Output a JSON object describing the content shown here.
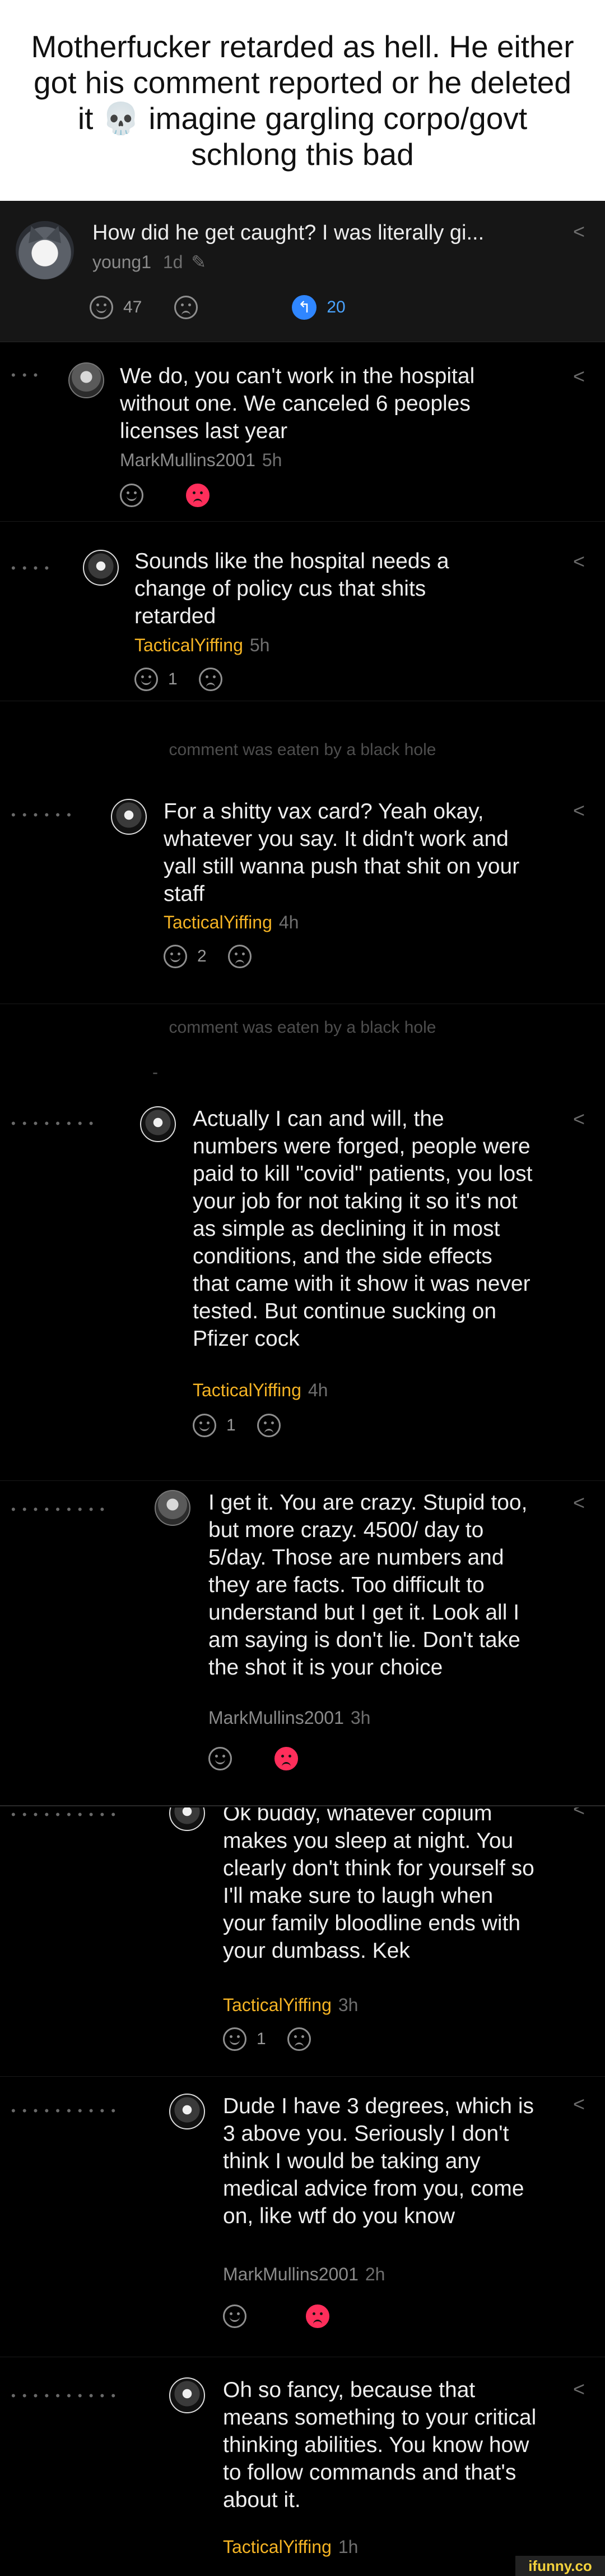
{
  "caption": "Motherfucker retarded as hell. He either got his comment reported or he deleted it 💀 imagine gargling corpo/govt schlong this bad",
  "post": {
    "title": "How did he get caught? I was literally gi...",
    "username": "young1",
    "age": "1d",
    "like_count": "47",
    "reply_count": "20"
  },
  "comments": [
    {
      "text": "We do, you can't work in the hospital without one. We canceled 6 peoples licenses last year",
      "username": "MarkMullins2001",
      "age": "5h",
      "like_count": "",
      "depth_dots": "• • •"
    },
    {
      "text": "Sounds like the hospital needs a change of policy cus that shits retarded",
      "username": "TacticalYiffing",
      "age": "5h",
      "like_count": "1",
      "depth_dots": "• • • •"
    },
    {
      "text": "For a shitty vax card? Yeah okay, whatever you say. It didn't work and yall still wanna push that shit on your staff",
      "username": "TacticalYiffing",
      "age": "4h",
      "like_count": "2",
      "depth_dots": "• • • • • •"
    },
    {
      "text": "Actually I can and will, the numbers were forged, people were paid to kill \"covid\" patients, you lost your job for not taking it so it's not as simple as declining it in most conditions, and the side effects that came with it show it was never tested. But continue sucking on Pfizer cock",
      "username": "TacticalYiffing",
      "age": "4h",
      "like_count": "1",
      "depth_dots": "• • • • • • • •"
    },
    {
      "text": "I get it. You are crazy. Stupid too, but more crazy. 4500/ day to 5/day. Those are numbers and they are facts. Too difficult to understand but I get it. Look all I am saying is don't lie. Don't take the shot it is your choice",
      "username": "MarkMullins2001",
      "age": "3h",
      "like_count": "",
      "depth_dots": "• • • • • • • • •"
    },
    {
      "text": "Ok buddy, whatever copium makes you sleep at night. You clearly don't think for yourself so I'll make sure to laugh when your family bloodline ends with your dumbass. Kek",
      "username": "TacticalYiffing",
      "age": "3h",
      "like_count": "1",
      "depth_dots": "• • • • • • • • • •"
    },
    {
      "text": "Dude I have 3 degrees, which is 3 above you. Seriously I don't think I would be taking any medical advice from you, come on, like wtf do you know",
      "username": "MarkMullins2001",
      "age": "2h",
      "like_count": "",
      "depth_dots": "• • • • • • • • • •"
    },
    {
      "text": "Oh so fancy, because that means something to your critical thinking abilities. You know how to follow commands and that's about it.",
      "username": "TacticalYiffing",
      "age": "1h",
      "like_count": "",
      "depth_dots": "• • • • • • • • • •"
    }
  ],
  "deleted_notice": "comment was eaten by a black hole",
  "deleted_dash": "-",
  "share_glyph": "<",
  "reply_glyph": "↰",
  "edit_glyph": "✎",
  "watermark": "ifunny.co"
}
